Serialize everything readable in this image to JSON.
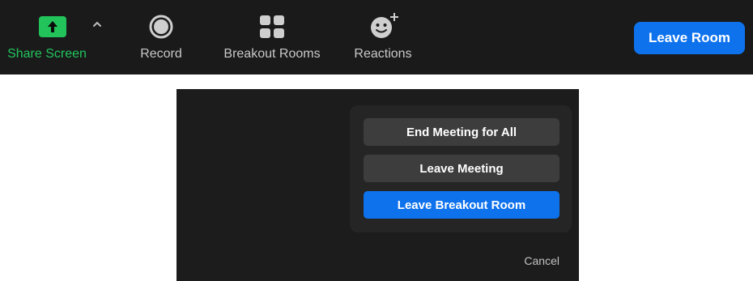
{
  "toolbar": {
    "share_screen": {
      "label": "Share Screen",
      "icon": "share-screen-icon",
      "accent": "#22c55e"
    },
    "share_options": {
      "icon": "chevron-up-icon"
    },
    "record": {
      "label": "Record",
      "icon": "record-icon"
    },
    "breakout_rooms": {
      "label": "Breakout Rooms",
      "icon": "breakout-rooms-icon"
    },
    "reactions": {
      "label": "Reactions",
      "icon": "reactions-icon"
    },
    "leave_room": {
      "label": "Leave Room",
      "color": "#0e72ed"
    }
  },
  "leave_dialog": {
    "options": [
      {
        "label": "End Meeting for All"
      },
      {
        "label": "Leave Meeting"
      },
      {
        "label": "Leave Breakout Room"
      }
    ],
    "cancel_label": "Cancel"
  }
}
